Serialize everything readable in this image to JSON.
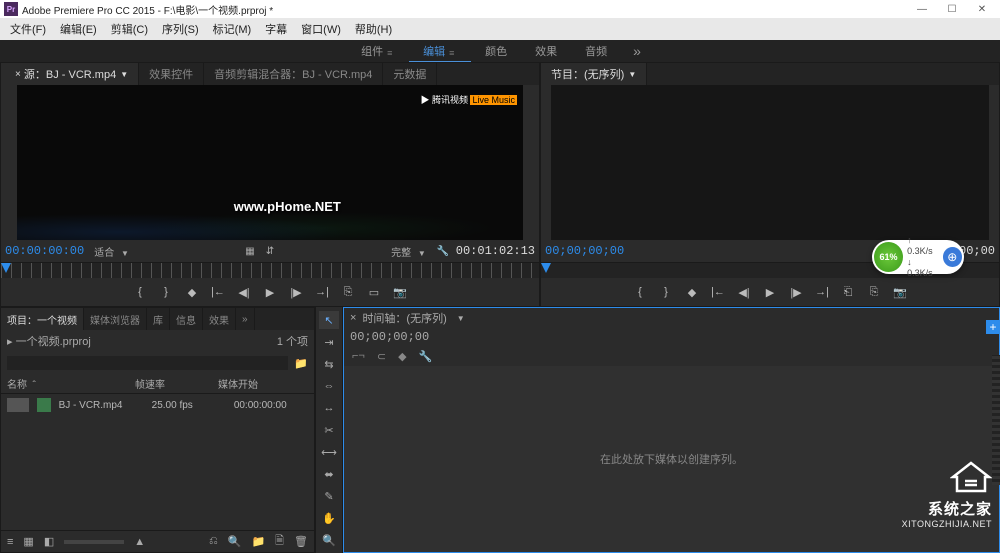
{
  "app": {
    "icon_text": "Pr",
    "title": "Adobe Premiere Pro CC 2015 - F:\\电影\\一个视频.prproj *"
  },
  "menus": [
    "文件(F)",
    "编辑(E)",
    "剪辑(C)",
    "序列(S)",
    "标记(M)",
    "字幕",
    "窗口(W)",
    "帮助(H)"
  ],
  "workspaces": {
    "tabs": [
      "组件",
      "编辑",
      "颜色",
      "效果",
      "音频"
    ],
    "active_index": 1,
    "more": "»"
  },
  "source": {
    "tabs": [
      "源：BJ - VCR.mp4",
      "效果控件",
      "音频剪辑混合器：BJ - VCR.mp4",
      "元数据"
    ],
    "active_index": 0,
    "watermark_brand": "腾讯视频",
    "watermark_tag": "Live Music",
    "phome": "www.pHome.NET",
    "in_tc": "00:00:00:00",
    "fit_label": "适合",
    "end_label": "完整",
    "out_tc": "00:01:02:13"
  },
  "program": {
    "title": "节目：(无序列)",
    "tc": "00;00;00;00",
    "out_tc": "00;00;00;00"
  },
  "project": {
    "tabs": [
      "项目：一个视频",
      "媒体浏览器",
      "库",
      "信息",
      "效果"
    ],
    "more": "»",
    "active_index": 0,
    "file": "一个视频.prproj",
    "count": "1 个项",
    "cols": {
      "name": "名称",
      "fps": "帧速率",
      "start": "媒体开始"
    },
    "items": [
      {
        "name": "BJ - VCR.mp4",
        "fps": "25.00 fps",
        "start": "00:00:00:00"
      }
    ]
  },
  "timeline": {
    "title": "时间轴：(无序列)",
    "tc": "00;00;00;00",
    "empty_hint": "在此处放下媒体以创建序列。"
  },
  "net": {
    "pct": "61%",
    "up": "0.3K/s",
    "down": "0.3K/s"
  },
  "site": {
    "cn": "系统之家",
    "en": "XITONGZHIJIA.NET"
  },
  "colors": {
    "accent": "#2d8ceb",
    "accent2": "#4a90d9"
  }
}
